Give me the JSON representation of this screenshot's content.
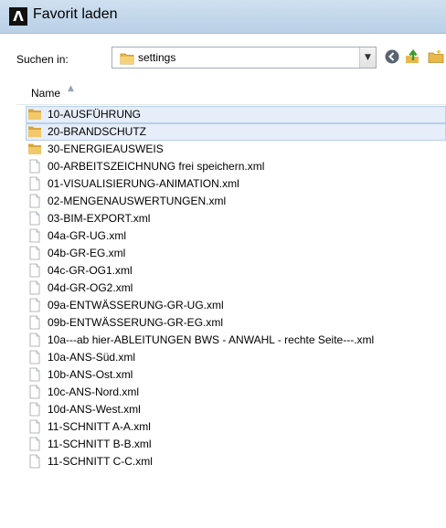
{
  "window": {
    "title": "Favorit laden",
    "logo_glyph": "Λ"
  },
  "toolbar": {
    "look_in_label": "Suchen in:",
    "look_in_value": "settings",
    "icons": [
      "back-icon",
      "up-folder-icon",
      "new-folder-icon"
    ]
  },
  "list": {
    "column_name": "Name",
    "sort": "ascending",
    "items": [
      {
        "name": "10-AUSFÜHRUNG",
        "type": "folder",
        "selected": true
      },
      {
        "name": "20-BRANDSCHUTZ",
        "type": "folder",
        "selected": true
      },
      {
        "name": "30-ENERGIEAUSWEIS",
        "type": "folder",
        "selected": false
      },
      {
        "name": "00-ARBEITSZEICHNUNG frei speichern.xml",
        "type": "file",
        "selected": false
      },
      {
        "name": "01-VISUALISIERUNG-ANIMATION.xml",
        "type": "file",
        "selected": false
      },
      {
        "name": "02-MENGENAUSWERTUNGEN.xml",
        "type": "file",
        "selected": false
      },
      {
        "name": "03-BIM-EXPORT.xml",
        "type": "file",
        "selected": false
      },
      {
        "name": "04a-GR-UG.xml",
        "type": "file",
        "selected": false
      },
      {
        "name": "04b-GR-EG.xml",
        "type": "file",
        "selected": false
      },
      {
        "name": "04c-GR-OG1.xml",
        "type": "file",
        "selected": false
      },
      {
        "name": "04d-GR-OG2.xml",
        "type": "file",
        "selected": false
      },
      {
        "name": "09a-ENTWÄSSERUNG-GR-UG.xml",
        "type": "file",
        "selected": false
      },
      {
        "name": "09b-ENTWÄSSERUNG-GR-EG.xml",
        "type": "file",
        "selected": false
      },
      {
        "name": "10a---ab hier-ABLEITUNGEN BWS - ANWAHL - rechte Seite---.xml",
        "type": "file",
        "selected": false
      },
      {
        "name": "10a-ANS-Süd.xml",
        "type": "file",
        "selected": false
      },
      {
        "name": "10b-ANS-Ost.xml",
        "type": "file",
        "selected": false
      },
      {
        "name": "10c-ANS-Nord.xml",
        "type": "file",
        "selected": false
      },
      {
        "name": "10d-ANS-West.xml",
        "type": "file",
        "selected": false
      },
      {
        "name": "11-SCHNITT A-A.xml",
        "type": "file",
        "selected": false
      },
      {
        "name": "11-SCHNITT B-B.xml",
        "type": "file",
        "selected": false
      },
      {
        "name": "11-SCHNITT C-C.xml",
        "type": "file",
        "selected": false
      }
    ]
  },
  "colors": {
    "titlebar": "#c4d8ec",
    "selection": "#e5eef9",
    "folder": "#e8b94a"
  }
}
